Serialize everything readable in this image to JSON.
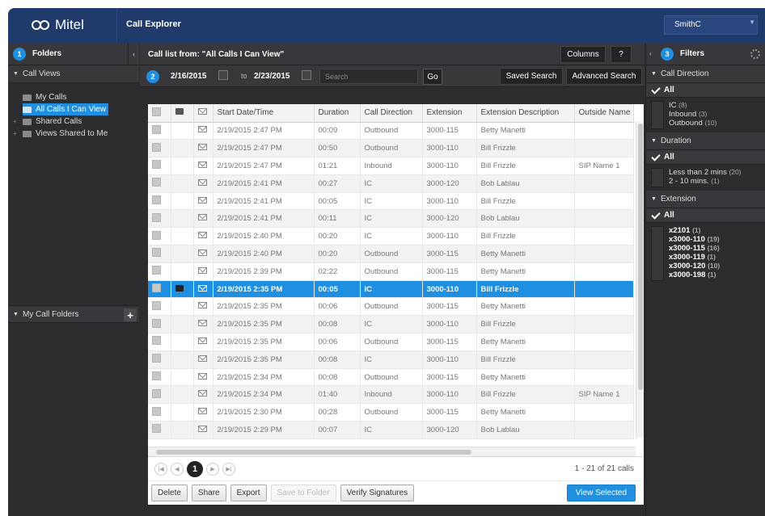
{
  "header": {
    "logo_text": "Mitel",
    "app_title": "Call Explorer",
    "user": "SmithC"
  },
  "left_panel": {
    "step": "1",
    "title": "Folders",
    "call_views_label": "Call Views",
    "tree": [
      {
        "label": "My Calls",
        "selected": false
      },
      {
        "label": "All Calls I Can View",
        "selected": true
      },
      {
        "label": "Shared Calls",
        "selected": false
      },
      {
        "label": "Views Shared to Me",
        "selected": false
      }
    ],
    "my_call_folders_label": "My Call Folders"
  },
  "center_panel": {
    "list_title": "Call list from: \"All Calls I Can View\"",
    "columns_button": "Columns",
    "help_icon": "?",
    "step": "2",
    "date_from": "2/16/2015",
    "to_label": "to",
    "date_to": "2/23/2015",
    "search_placeholder": "Search",
    "go_button": "Go",
    "saved_search_button": "Saved Search",
    "advanced_search_button": "Advanced Search",
    "columns": [
      "Start Date/Time",
      "Duration",
      "Call Direction",
      "Extension",
      "Extension Description",
      "Outside Name"
    ],
    "rows": [
      {
        "date": "2/19/2015 2:47 PM",
        "duration": "00:09",
        "direction": "Outbound",
        "extension": "3000-115",
        "description": "Betty Manetti",
        "outside": ""
      },
      {
        "date": "2/19/2015 2:47 PM",
        "duration": "00:50",
        "direction": "Outbound",
        "extension": "3000-110",
        "description": "Bill Frizzle",
        "outside": ""
      },
      {
        "date": "2/19/2015 2:47 PM",
        "duration": "01:21",
        "direction": "Inbound",
        "extension": "3000-110",
        "description": "Bill Frizzle",
        "outside": "SIP Name 1"
      },
      {
        "date": "2/19/2015 2:41 PM",
        "duration": "00:27",
        "direction": "IC",
        "extension": "3000-120",
        "description": "Bob Lablau",
        "outside": ""
      },
      {
        "date": "2/19/2015 2:41 PM",
        "duration": "00:05",
        "direction": "IC",
        "extension": "3000-110",
        "description": "Bill Frizzle",
        "outside": ""
      },
      {
        "date": "2/19/2015 2:41 PM",
        "duration": "00:11",
        "direction": "IC",
        "extension": "3000-120",
        "description": "Bob Lablau",
        "outside": ""
      },
      {
        "date": "2/19/2015 2:40 PM",
        "duration": "00:20",
        "direction": "IC",
        "extension": "3000-110",
        "description": "Bill Frizzle",
        "outside": ""
      },
      {
        "date": "2/19/2015 2:40 PM",
        "duration": "00:20",
        "direction": "Outbound",
        "extension": "3000-115",
        "description": "Betty Manetti",
        "outside": ""
      },
      {
        "date": "2/19/2015 2:39 PM",
        "duration": "02:22",
        "direction": "Outbound",
        "extension": "3000-115",
        "description": "Betty Manetti",
        "outside": ""
      },
      {
        "date": "2/19/2015 2:35 PM",
        "duration": "00:05",
        "direction": "IC",
        "extension": "3000-110",
        "description": "Bill Frizzle",
        "outside": "",
        "selected": true
      },
      {
        "date": "2/19/2015 2:35 PM",
        "duration": "00:06",
        "direction": "Outbound",
        "extension": "3000-115",
        "description": "Betty Manetti",
        "outside": ""
      },
      {
        "date": "2/19/2015 2:35 PM",
        "duration": "00:08",
        "direction": "IC",
        "extension": "3000-110",
        "description": "Bill Frizzle",
        "outside": ""
      },
      {
        "date": "2/19/2015 2:35 PM",
        "duration": "00:06",
        "direction": "Outbound",
        "extension": "3000-115",
        "description": "Betty Manetti",
        "outside": ""
      },
      {
        "date": "2/19/2015 2:35 PM",
        "duration": "00:08",
        "direction": "IC",
        "extension": "3000-110",
        "description": "Bill Frizzle",
        "outside": ""
      },
      {
        "date": "2/19/2015 2:34 PM",
        "duration": "00:08",
        "direction": "Outbound",
        "extension": "3000-115",
        "description": "Betty Manetti",
        "outside": ""
      },
      {
        "date": "2/19/2015 2:34 PM",
        "duration": "01:40",
        "direction": "Inbound",
        "extension": "3000-110",
        "description": "Bill Frizzle",
        "outside": "SIP Name 1"
      },
      {
        "date": "2/19/2015 2:30 PM",
        "duration": "00:28",
        "direction": "Outbound",
        "extension": "3000-115",
        "description": "Betty Manetti",
        "outside": ""
      },
      {
        "date": "2/19/2015 2:29 PM",
        "duration": "00:07",
        "direction": "IC",
        "extension": "3000-120",
        "description": "Bob Lablau",
        "outside": ""
      }
    ],
    "pager": {
      "current_page": "1",
      "count_text": "1 - 21 of 21 calls"
    },
    "actions": {
      "delete": "Delete",
      "share": "Share",
      "export": "Export",
      "save_to_folder": "Save to Folder",
      "verify": "Verify Signatures",
      "view_selected": "View Selected"
    }
  },
  "right_panel": {
    "step": "3",
    "title": "Filters",
    "sections": [
      {
        "label": "Call Direction",
        "all": "All",
        "items": [
          {
            "label": "IC",
            "count": "(8)",
            "bold": false
          },
          {
            "label": "Inbound",
            "count": "(3)",
            "bold": false
          },
          {
            "label": "Outbound",
            "count": "(10)",
            "bold": false
          }
        ]
      },
      {
        "label": "Duration",
        "all": "All",
        "items": [
          {
            "label": "Less than 2 mins",
            "count": "(20)",
            "bold": false
          },
          {
            "label": "2 - 10 mins.",
            "count": "(1)",
            "bold": false
          }
        ]
      },
      {
        "label": "Extension",
        "all": "All",
        "items": [
          {
            "label": "x2101",
            "count": "(1)",
            "bold": true
          },
          {
            "label": "x3000-110",
            "count": "(19)",
            "bold": true
          },
          {
            "label": "x3000-115",
            "count": "(16)",
            "bold": true
          },
          {
            "label": "x3000-119",
            "count": "(1)",
            "bold": true
          },
          {
            "label": "x3000-120",
            "count": "(10)",
            "bold": true
          },
          {
            "label": "x3000-198",
            "count": "(1)",
            "bold": true
          }
        ]
      }
    ]
  },
  "colors": {
    "brand_blue": "#1f3a6b",
    "accent": "#1e8fe1",
    "panel_bg": "#2d2d30"
  }
}
